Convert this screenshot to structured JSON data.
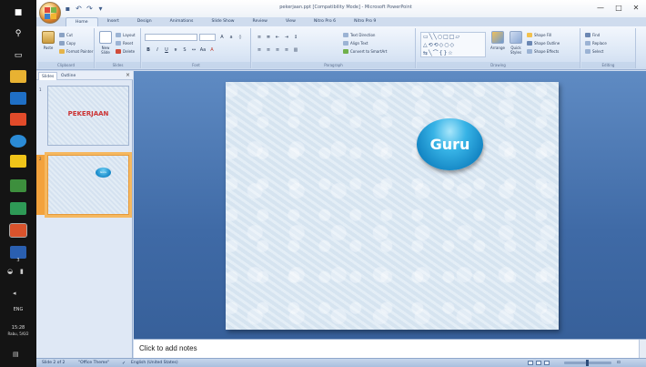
{
  "window": {
    "title": "pekerjaan.ppt [Compatibility Mode] - Microsoft PowerPoint",
    "minimize_glyph": "—",
    "maximize_glyph": "□",
    "close_glyph": "✕"
  },
  "qat": {
    "save_icon": "save-icon",
    "undo_icon": "undo-icon",
    "redo_icon": "redo-icon"
  },
  "tabs": [
    "Home",
    "Insert",
    "Design",
    "Animations",
    "Slide Show",
    "Review",
    "View",
    "Nitro Pro 6",
    "Nitro Pro 9"
  ],
  "active_tab": "Home",
  "ribbon": {
    "clipboard": {
      "label": "Clipboard",
      "paste": "Paste",
      "cut": "Cut",
      "copy": "Copy",
      "format_painter": "Format Painter"
    },
    "slides": {
      "label": "Slides",
      "new_slide": "New Slide",
      "layout": "Layout",
      "reset": "Reset",
      "delete": "Delete"
    },
    "font": {
      "label": "Font",
      "font_name": "",
      "font_size": ""
    },
    "paragraph": {
      "label": "Paragraph",
      "text_direction": "Text Direction",
      "align_text": "Align Text",
      "convert_smartart": "Convert to SmartArt"
    },
    "drawing": {
      "label": "Drawing",
      "arrange": "Arrange",
      "quick_styles": "Quick Styles",
      "shape_fill": "Shape Fill",
      "shape_outline": "Shape Outline",
      "shape_effects": "Shape Effects"
    },
    "editing": {
      "label": "Editing",
      "find": "Find",
      "replace": "Replace",
      "select": "Select"
    }
  },
  "slides_pane": {
    "tab_slides": "Slides",
    "tab_outline": "Outline",
    "close": "×",
    "thumbnails": [
      {
        "number": "1",
        "title": "PEKERJAAN"
      },
      {
        "number": "2",
        "shape_text": "Guru"
      }
    ]
  },
  "slide": {
    "shape_text": "Guru"
  },
  "notes": {
    "placeholder": "Click to add notes"
  },
  "status": {
    "slide_info": "Slide 2 of 2",
    "theme": "\"Office Theme\"",
    "language": "English (United States)",
    "zoom": ""
  },
  "taskbar": {
    "tray_num": "3",
    "tray_lang": "ENG",
    "time": "15:28",
    "date": "Rabu, 5/6/2"
  },
  "colors": {
    "ribbon": "#dde8f6",
    "stage": "#4f7bb6",
    "slide_bg": "#dde9f4",
    "shape": "#1789c9",
    "thumb_title": "#cc3333",
    "selection": "#f5b860"
  }
}
